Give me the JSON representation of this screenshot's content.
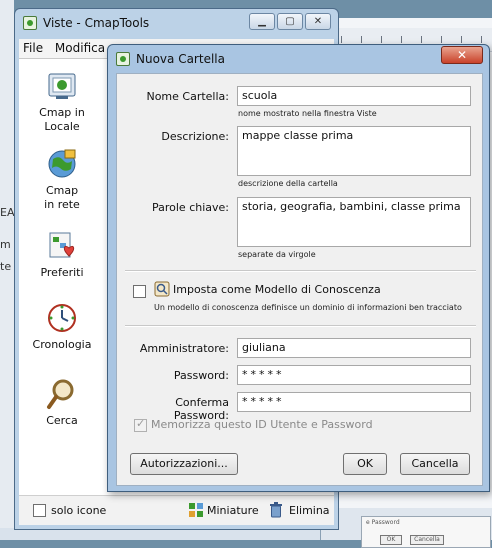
{
  "viste_window": {
    "title": "Viste - CmapTools",
    "menu": [
      "File",
      "Modifica"
    ],
    "nav": [
      {
        "label_line1": "Cmap in",
        "label_line2": "Locale",
        "icon": "cmap-local-icon"
      },
      {
        "label_line1": "Cmap",
        "label_line2": "in rete",
        "icon": "cmap-network-icon"
      },
      {
        "label_line1": "Preferiti",
        "label_line2": "",
        "icon": "favorites-icon"
      },
      {
        "label_line1": "Cronologia",
        "label_line2": "",
        "icon": "history-icon"
      },
      {
        "label_line1": "Cerca",
        "label_line2": "",
        "icon": "search-icon"
      }
    ],
    "footer": {
      "solo_icone": "solo icone",
      "miniature": "Miniature",
      "elimina": "Elimina"
    }
  },
  "dialog": {
    "title": "Nuova Cartella",
    "close": "✕",
    "nome_label": "Nome Cartella:",
    "nome_value": "scuola",
    "nome_hint": "nome mostrato nella finestra Viste",
    "descr_label": "Descrizione:",
    "descr_value": "mappe classe prima",
    "descr_hint": "descrizione della cartella",
    "parole_label": "Parole chiave:",
    "parole_value": "storia, geografia, bambini, classe prima",
    "parole_hint": "separate da virgole",
    "modello_label": "Imposta come Modello di Conoscenza",
    "modello_desc": "Un modello di conoscenza definisce un dominio di informazioni ben tracciato",
    "admin_label": "Amministratore:",
    "admin_value": "giuliana",
    "password_label": "Password:",
    "password_value": "*****",
    "conferma_label": "Conferma Password:",
    "conferma_value": "*****",
    "memorizza_label": "Memorizza questo ID Utente e Password",
    "autorizzazioni_button": "Autorizzazioni...",
    "ok_button": "OK",
    "cancella_button": "Cancella"
  },
  "background": {
    "left_letters": [
      "EA",
      "m",
      "te"
    ],
    "right_mini_ok": "OK",
    "right_mini_cancel": "Cancella",
    "right_mini_text": "e Password"
  },
  "colors": {
    "window_frame": "#bcd2e7",
    "dialog_frame": "#a9c5e2",
    "close_button": "#c9422a"
  }
}
